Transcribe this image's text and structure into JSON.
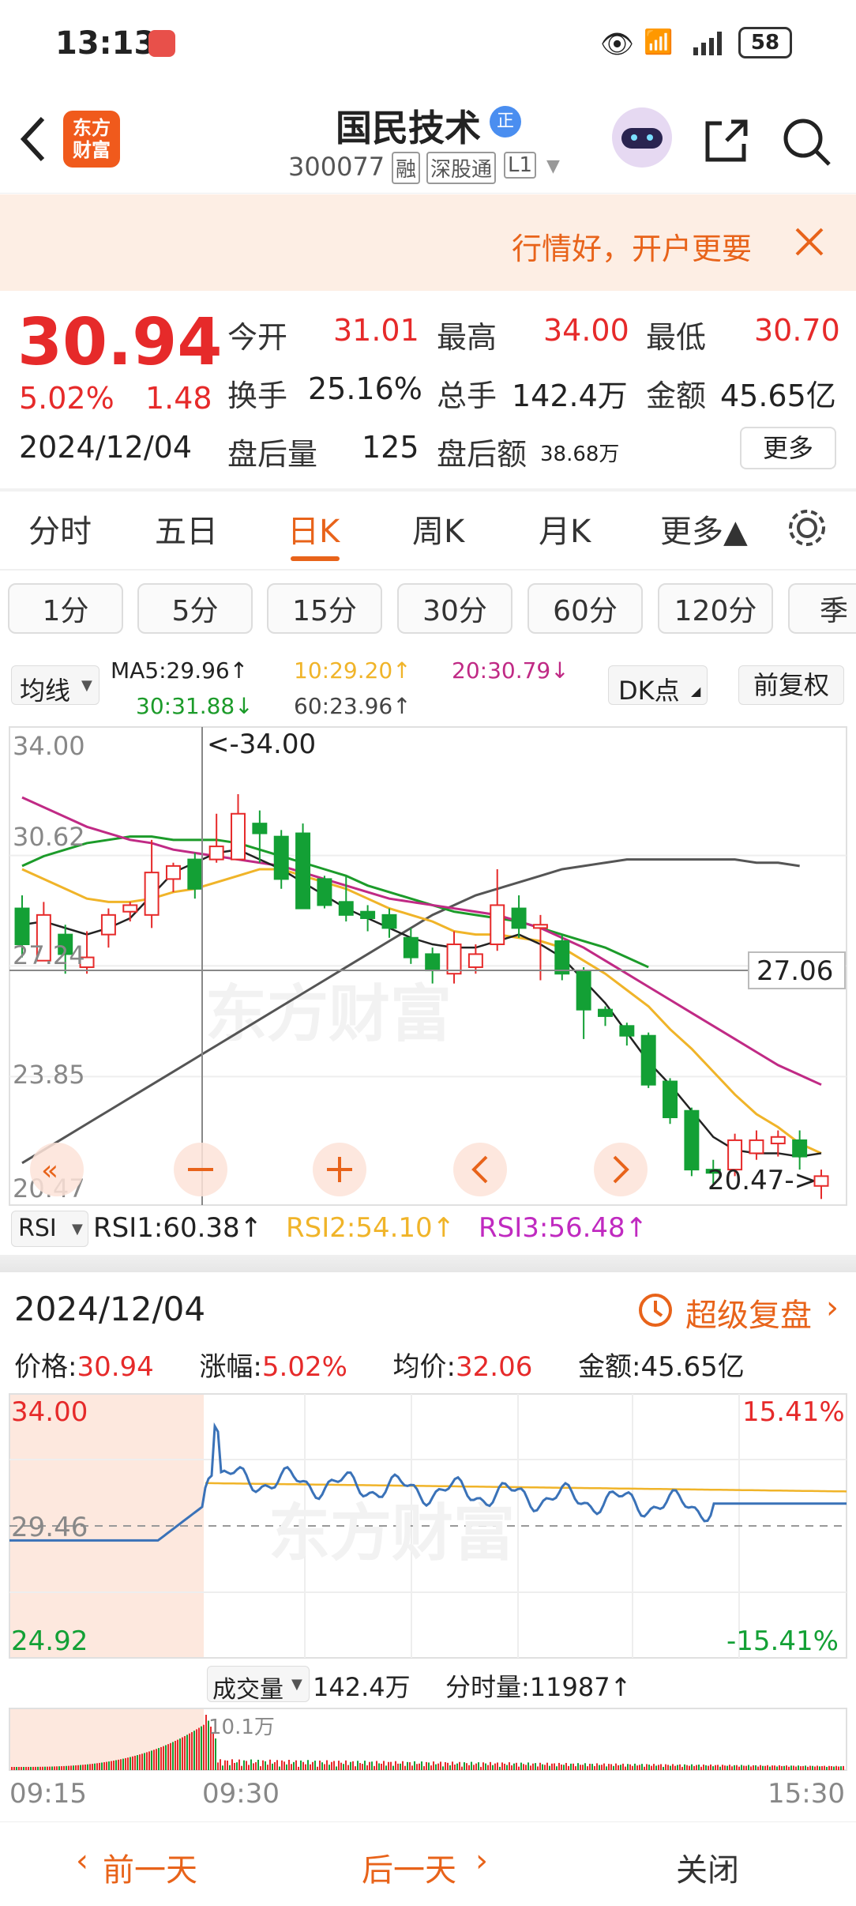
{
  "status_bar": {
    "time": "13:13",
    "battery": "58"
  },
  "header": {
    "back_icon": "back-arrow-icon",
    "logo_text": "东方\n财富",
    "stock_name": "国民技术",
    "badge": "正",
    "code": "300077",
    "tags": [
      "融",
      "深股通",
      "L1"
    ]
  },
  "banner": {
    "text": "行情好，开户更要"
  },
  "quote": {
    "price": "30.94",
    "change_pct": "5.02%",
    "change": "1.48",
    "date": "2024/12/04",
    "fields": [
      {
        "label": "今开",
        "value": "31.01"
      },
      {
        "label": "最高",
        "value": "34.00"
      },
      {
        "label": "最低",
        "value": "30.70"
      },
      {
        "label": "换手",
        "value": "25.16%"
      },
      {
        "label": "总手",
        "value": "142.4万"
      },
      {
        "label": "金额",
        "value": "45.65亿"
      },
      {
        "label": "盘后量",
        "value": "125"
      },
      {
        "label": "盘后额",
        "value": "38.68万"
      }
    ],
    "more": "更多"
  },
  "period_tabs": [
    "分时",
    "五日",
    "日K",
    "周K",
    "月K",
    "更多▲"
  ],
  "active_tab": "日K",
  "minute_buttons": [
    "1分",
    "5分",
    "15分",
    "30分",
    "60分",
    "120分",
    "季"
  ],
  "indicator_bar": {
    "selector": "均线",
    "ma5": "MA5:29.96↑",
    "ma10": "10:29.20↑",
    "ma20": "20:30.79↓",
    "ma30": "30:31.88↓",
    "ma60": "60:23.96↑",
    "dk": "DK点",
    "fq": "前复权"
  },
  "kline": {
    "y_labels": [
      "34.00",
      "30.62",
      "27.24",
      "23.85",
      "20.47"
    ],
    "high_marker": "<-34.00",
    "low_marker": "20.47->",
    "cursor_value": "27.06",
    "candles": [
      [
        29.0,
        27.9,
        29.4,
        27.5
      ],
      [
        27.4,
        28.8,
        29.2,
        27.4
      ],
      [
        28.2,
        27.6,
        28.5,
        27.0
      ],
      [
        27.2,
        27.5,
        28.3,
        27.0
      ],
      [
        28.2,
        28.8,
        29.0,
        27.8
      ],
      [
        28.9,
        29.1,
        29.2,
        28.6
      ],
      [
        28.8,
        30.1,
        31.1,
        28.4
      ],
      [
        29.9,
        30.3,
        30.4,
        29.5
      ],
      [
        30.5,
        29.6,
        30.7,
        29.3
      ],
      [
        30.5,
        30.9,
        31.9,
        30.4
      ],
      [
        30.5,
        31.9,
        32.5,
        30.5
      ],
      [
        31.6,
        31.3,
        32.0,
        30.4
      ],
      [
        31.2,
        29.9,
        31.4,
        29.6
      ],
      [
        31.3,
        29.0,
        31.6,
        29.0
      ],
      [
        29.9,
        29.1,
        30.0,
        29.0
      ],
      [
        29.2,
        28.8,
        30.0,
        28.6
      ],
      [
        28.9,
        28.7,
        29.1,
        28.3
      ],
      [
        28.8,
        28.4,
        29.0,
        28.1
      ],
      [
        28.1,
        27.5,
        28.4,
        27.3
      ],
      [
        27.6,
        27.1,
        27.8,
        26.7
      ],
      [
        27.0,
        27.9,
        28.3,
        26.7
      ],
      [
        27.2,
        27.6,
        27.9,
        27.0
      ],
      [
        27.9,
        29.1,
        30.2,
        27.7
      ],
      [
        29.0,
        28.4,
        29.4,
        28.1
      ],
      [
        28.4,
        28.5,
        28.8,
        26.8
      ],
      [
        28.0,
        27.0,
        28.2,
        26.8
      ],
      [
        27.1,
        25.9,
        27.2,
        25.0
      ],
      [
        25.9,
        25.7,
        26.0,
        25.4
      ],
      [
        25.4,
        25.1,
        25.5,
        24.8
      ],
      [
        25.1,
        23.6,
        25.2,
        23.5
      ],
      [
        23.7,
        22.6,
        23.8,
        22.4
      ],
      [
        22.8,
        21.0,
        22.9,
        20.8
      ],
      [
        21.0,
        20.9,
        21.3,
        20.5
      ],
      [
        21.0,
        21.9,
        22.1,
        20.8
      ],
      [
        21.5,
        21.9,
        22.2,
        21.3
      ],
      [
        21.8,
        22.0,
        22.2,
        21.4
      ],
      [
        21.9,
        21.4,
        22.2,
        21.0
      ],
      [
        20.5,
        20.8,
        21.0,
        20.1
      ]
    ],
    "ma5": [
      28.5,
      28.6,
      28.4,
      28.2,
      28.4,
      28.7,
      29.4,
      30.1,
      30.4,
      30.7,
      30.8,
      30.5,
      30.2,
      29.8,
      29.4,
      29.0,
      28.7,
      28.4,
      28.1,
      27.9,
      27.8,
      27.8,
      28.0,
      28.2,
      27.9,
      27.5,
      26.8,
      26.1,
      25.2,
      24.3,
      23.6,
      22.8,
      22.0,
      21.6,
      21.5,
      21.5,
      21.4,
      21.5
    ],
    "ma10": [
      30.2,
      29.9,
      29.6,
      29.3,
      29.2,
      29.2,
      29.3,
      29.5,
      29.6,
      29.8,
      30.0,
      30.2,
      30.2,
      30.0,
      29.8,
      29.6,
      29.3,
      29.0,
      28.8,
      28.6,
      28.3,
      28.2,
      28.2,
      28.1,
      28.0,
      27.8,
      27.4,
      27.0,
      26.5,
      26.0,
      25.3,
      24.7,
      24.0,
      23.3,
      22.7,
      22.3,
      21.8,
      21.5
    ],
    "ma20": [
      32.4,
      32.1,
      31.8,
      31.5,
      31.3,
      31.1,
      31.0,
      30.8,
      30.7,
      30.6,
      30.5,
      30.4,
      30.3,
      30.1,
      29.9,
      29.7,
      29.5,
      29.3,
      29.2,
      29.1,
      29.0,
      28.9,
      28.8,
      28.6,
      28.4,
      28.1,
      27.8,
      27.4,
      27.0,
      26.6,
      26.2,
      25.8,
      25.4,
      25.0,
      24.6,
      24.2,
      23.9,
      23.6
    ],
    "ma30": [
      30.3,
      30.6,
      30.8,
      31.0,
      31.1,
      31.2,
      31.2,
      31.1,
      31.1,
      31.1,
      31.0,
      30.8,
      30.6,
      30.4,
      30.2,
      30.0,
      29.7,
      29.5,
      29.3,
      29.1,
      28.9,
      28.8,
      28.7,
      28.6,
      28.4,
      28.2,
      28.0,
      27.8,
      27.5,
      27.2
    ],
    "ma60": [
      21.2,
      21.6,
      22.0,
      22.4,
      22.8,
      23.2,
      23.6,
      24.0,
      24.4,
      24.8,
      25.2,
      25.6,
      26.0,
      26.4,
      26.8,
      27.2,
      27.6,
      28.0,
      28.4,
      28.8,
      29.1,
      29.4,
      29.6,
      29.8,
      30.0,
      30.2,
      30.3,
      30.4,
      30.5,
      30.5,
      30.5,
      30.5,
      30.5,
      30.5,
      30.4,
      30.4,
      30.3
    ]
  },
  "rsi": {
    "selector": "RSI",
    "rsi1": "RSI1:60.38↑",
    "rsi2": "RSI2:54.10↑",
    "rsi3": "RSI3:56.48↑"
  },
  "detail": {
    "date": "2024/12/04",
    "replay": "超级复盘",
    "price_label": "价格:",
    "price": "30.94",
    "chg_label": "涨幅:",
    "chg": "5.02%",
    "avg_label": "均价:",
    "avg": "32.06",
    "amt_label": "金额:",
    "amt": "45.65亿"
  },
  "intraday": {
    "y_top": "34.00",
    "y_mid": "29.46",
    "y_bot": "24.92",
    "pct_top": "15.41%",
    "pct_bot": "-15.41%",
    "vol_selector": "成交量",
    "vol_total": "142.4万",
    "vol_min": "分时量:11987↑",
    "vol_peak": "10.1万",
    "time_start": "09:15",
    "time_open": "09:30",
    "time_end": "15:30"
  },
  "bottom_nav": {
    "prev": "前一天",
    "next": "后一天",
    "close": "关闭"
  },
  "colors": {
    "up": "#e62a2a",
    "down": "#13a035",
    "accent": "#e8631a",
    "ma5": "#222222",
    "ma10": "#f0b429",
    "ma20": "#c02a85",
    "ma30": "#1c9b2a",
    "ma60": "#555555"
  }
}
